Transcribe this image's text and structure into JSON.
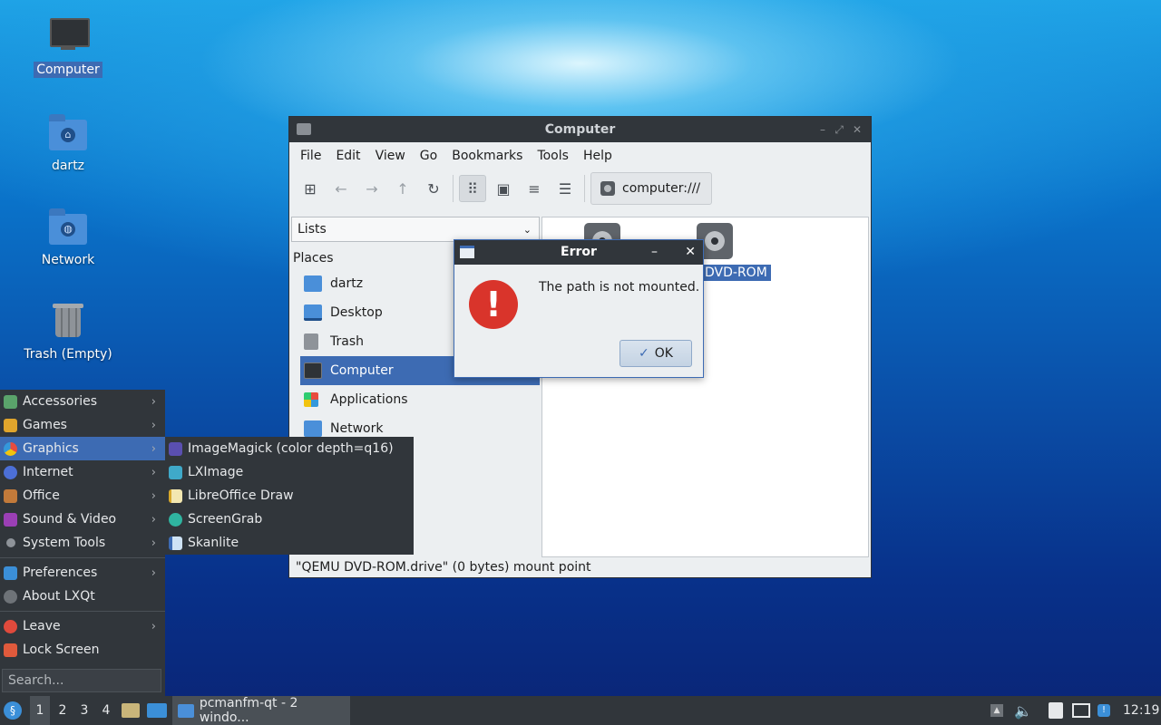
{
  "desktop": {
    "icons": [
      {
        "label": "Computer"
      },
      {
        "label": "dartz"
      },
      {
        "label": "Network"
      },
      {
        "label": "Trash (Empty)"
      }
    ]
  },
  "window": {
    "title": "Computer",
    "menu": [
      "File",
      "Edit",
      "View",
      "Go",
      "Bookmarks",
      "Tools",
      "Help"
    ],
    "path": "computer:///",
    "side_combo": "Lists",
    "places_header": "Places",
    "places": [
      {
        "label": "dartz"
      },
      {
        "label": "Desktop"
      },
      {
        "label": "Trash"
      },
      {
        "label": "Computer"
      },
      {
        "label": "Applications"
      },
      {
        "label": "Network"
      }
    ],
    "items": [
      {
        "label": "DVD-ROM"
      }
    ],
    "status": "\"QEMU DVD-ROM.drive\" (0 bytes) mount point"
  },
  "dialog": {
    "title": "Error",
    "message": "The path is not mounted.",
    "ok_label": "OK"
  },
  "start_menu": {
    "categories": [
      {
        "label": "Accessories"
      },
      {
        "label": "Games"
      },
      {
        "label": "Graphics"
      },
      {
        "label": "Internet"
      },
      {
        "label": "Office"
      },
      {
        "label": "Sound & Video"
      },
      {
        "label": "System Tools"
      }
    ],
    "preferences": "Preferences",
    "about": "About LXQt",
    "leave": "Leave",
    "lock": "Lock Screen",
    "search_placeholder": "Search..."
  },
  "graphics_submenu": [
    {
      "label": "ImageMagick (color depth=q16)"
    },
    {
      "label": "LXImage"
    },
    {
      "label": "LibreOffice Draw"
    },
    {
      "label": "ScreenGrab"
    },
    {
      "label": "Skanlite"
    }
  ],
  "taskbar": {
    "workspaces": [
      "1",
      "2",
      "3",
      "4"
    ],
    "task_label": "pcmanfm-qt - 2 windo...",
    "clock": "12:19"
  }
}
